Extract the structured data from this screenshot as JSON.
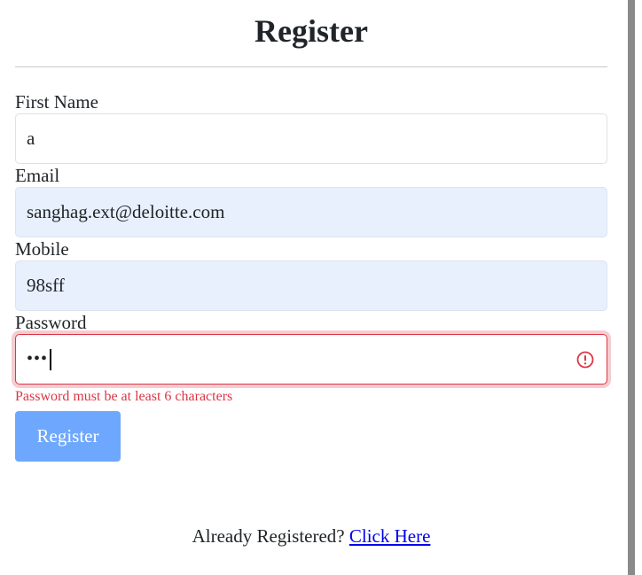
{
  "form": {
    "title": "Register",
    "fields": {
      "first_name": {
        "label": "First Name",
        "value": "a"
      },
      "email": {
        "label": "Email",
        "value": "sanghag.ext@deloitte.com"
      },
      "mobile": {
        "label": "Mobile",
        "value": "98sff"
      },
      "password": {
        "label": "Password",
        "masked_value": "•••",
        "error": "Password must be at least 6 characters"
      }
    },
    "submit_label": "Register"
  },
  "footer": {
    "prompt": "Already Registered?",
    "link_label": "Click Here"
  },
  "icons": {
    "password_status": "error-circle-icon"
  },
  "colors": {
    "error": "#dc3545",
    "button": "#6ea8fe",
    "autofill": "#e8f0fe",
    "link": "#0000ee"
  }
}
